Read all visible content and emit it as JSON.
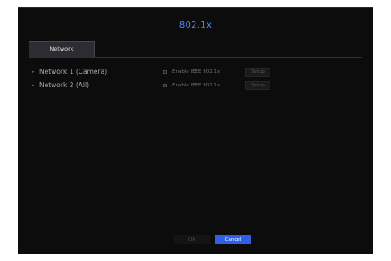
{
  "dialog": {
    "title": "802.1x",
    "tabs": [
      {
        "label": "Network"
      }
    ],
    "rows": [
      {
        "label": "Network 1 (Camera)",
        "checkbox_label": "Enable IEEE 802.1x",
        "checked": false,
        "setup_label": "Setup"
      },
      {
        "label": "Network 2 (All)",
        "checkbox_label": "Enable IEEE 802.1x",
        "checked": false,
        "setup_label": "Setup"
      }
    ],
    "ok_label": "OK",
    "cancel_label": "Cancel"
  },
  "colors": {
    "background": "#0c0c0c",
    "title": "#5a86ff",
    "primary_button": "#2e5fe6"
  }
}
